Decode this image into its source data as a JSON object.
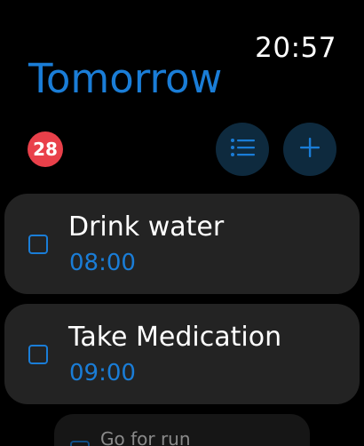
{
  "status": {
    "time": "20:57"
  },
  "header": {
    "title": "Tomorrow"
  },
  "toolbar": {
    "badge_count": "28",
    "list_icon": "list-icon",
    "add_icon": "plus-icon"
  },
  "tasks": [
    {
      "title": "Drink water",
      "time": "08:00"
    },
    {
      "title": "Take Medication",
      "time": "09:00"
    },
    {
      "title": "Go for run"
    }
  ],
  "colors": {
    "accent": "#1a7dd7",
    "badge": "#e9404a",
    "card": "#232323",
    "button_bg": "#0e2a3e"
  }
}
